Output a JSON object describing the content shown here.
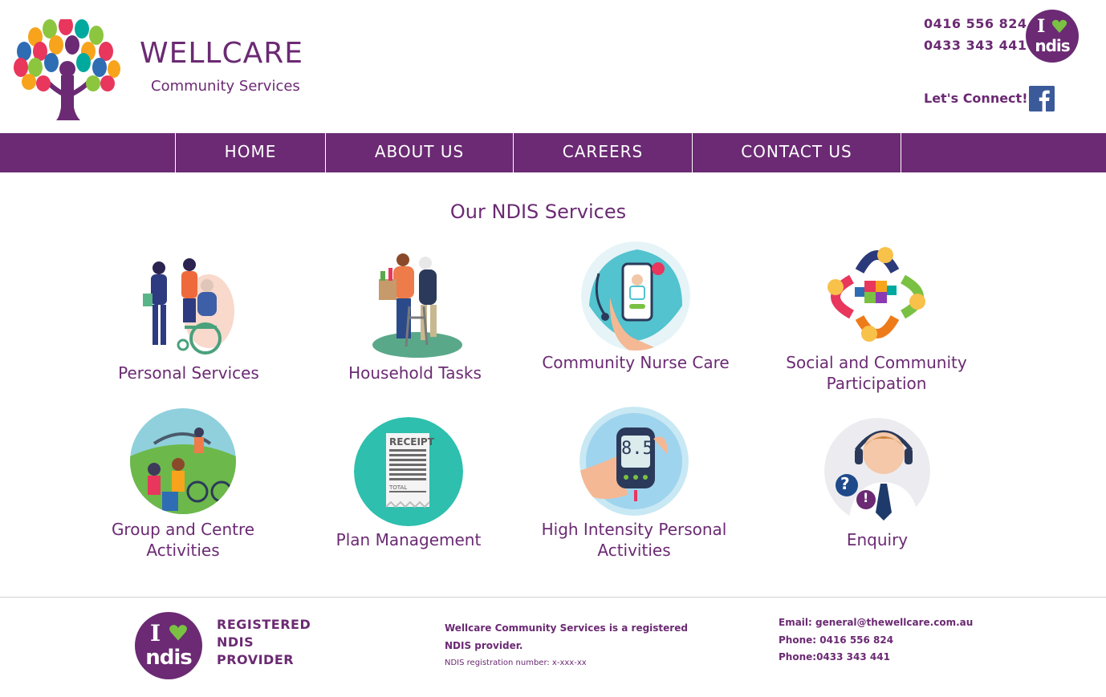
{
  "header": {
    "brand_name": "WELLCARE",
    "brand_subtitle": "Community Services",
    "phone_1": "0416 556 824",
    "phone_2": "0433 343 441",
    "connect_label": "Let's Connect!",
    "ndis_badge_top": "I",
    "ndis_badge_bottom": "ndis"
  },
  "nav": {
    "items": [
      {
        "label": "HOME"
      },
      {
        "label": "ABOUT US"
      },
      {
        "label": "CAREERS"
      },
      {
        "label": "CONTACT US"
      }
    ]
  },
  "services": {
    "title": "Our NDIS Services",
    "items": [
      {
        "label": "Personal Services",
        "icon": "personal-services-icon"
      },
      {
        "label": "Household Tasks",
        "icon": "household-tasks-icon"
      },
      {
        "label": "Community Nurse Care",
        "icon": "community-nurse-icon"
      },
      {
        "label": "Social and Community Participation",
        "icon": "social-participation-icon"
      },
      {
        "label": "Group and Centre Activities",
        "icon": "group-activities-icon"
      },
      {
        "label": "Plan Management",
        "icon": "plan-management-icon"
      },
      {
        "label": "High Intensity Personal Activities",
        "icon": "high-intensity-icon"
      },
      {
        "label": "Enquiry",
        "icon": "enquiry-icon"
      }
    ],
    "receipt_label": "RECEIPT",
    "receipt_total": "TOTAL",
    "glucose_reading": "8.5"
  },
  "footer": {
    "registered_line_1": "REGISTERED",
    "registered_line_2": "NDIS",
    "registered_line_3": "PROVIDER",
    "provider_text_1": "Wellcare Community Services is a registered",
    "provider_text_2": "NDIS provider.",
    "registration_text": "NDIS registration number: x-xxx-xx",
    "email": "Email: general@thewellcare.com.au",
    "phone_1": "Phone: 0416 556 824",
    "phone_2": "Phone:0433 343 441"
  },
  "colors": {
    "brand_purple": "#6b2a73",
    "ndis_green": "#7ac143",
    "facebook_blue": "#3b5a9a"
  }
}
